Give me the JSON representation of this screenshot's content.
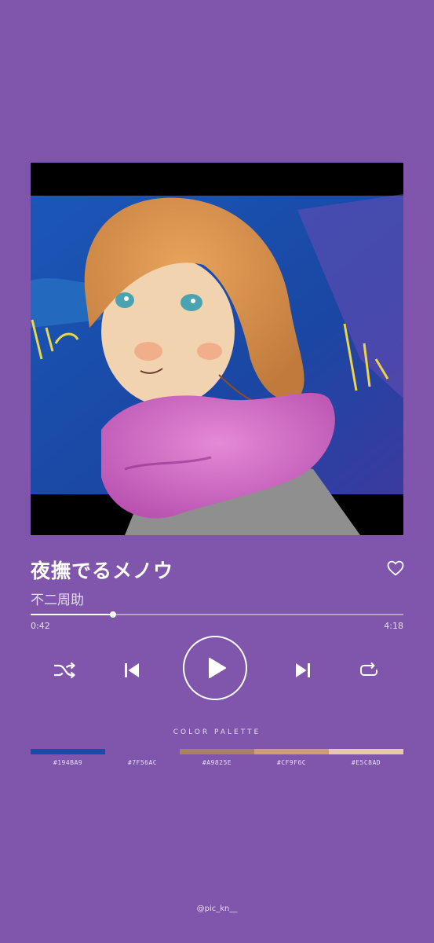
{
  "track": {
    "title": "夜撫でるメノウ",
    "artist": "不二周助"
  },
  "progress": {
    "elapsed": "0:42",
    "total": "4:18",
    "fraction": 0.22
  },
  "palette": {
    "title": "COLOR PALETTE",
    "colors": [
      {
        "hex": "#194BA9",
        "label": "#194BA9"
      },
      {
        "hex": "#7F56AC",
        "label": "#7F56AC"
      },
      {
        "hex": "#A9825E",
        "label": "#A9825E"
      },
      {
        "hex": "#CF9F6C",
        "label": "#CF9F6C"
      },
      {
        "hex": "#E5C8AD",
        "label": "#E5C8AD"
      }
    ]
  },
  "controls": {
    "shuffle_icon": "shuffle-icon",
    "previous_icon": "skip-previous-icon",
    "play_icon": "play-icon",
    "next_icon": "skip-next-icon",
    "repeat_icon": "repeat-icon",
    "like_icon": "heart-icon"
  },
  "credit": "@pic_kn__",
  "theme": {
    "background": "#7F56AC",
    "text": "#FFFFFF"
  }
}
